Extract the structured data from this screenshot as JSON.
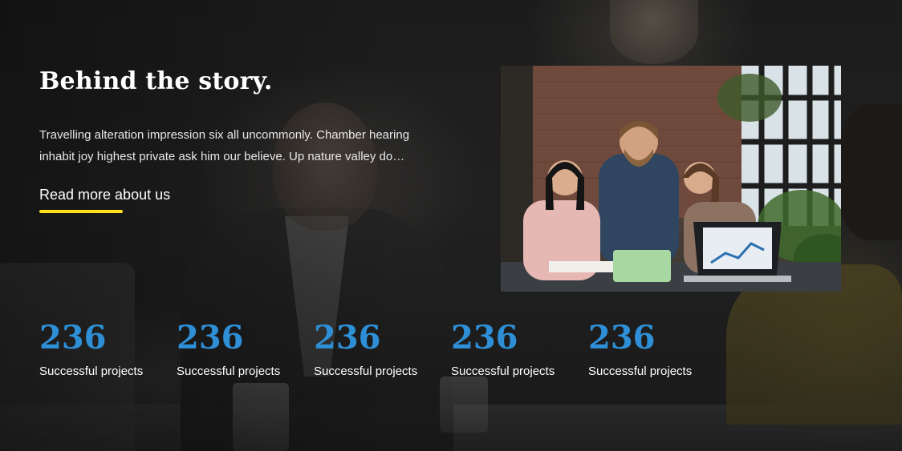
{
  "section": {
    "title": "Behind the story.",
    "description": "Travelling alteration impression six all uncommonly. Chamber hearing inhabit joy highest private ask him our believe. Up nature valley do…",
    "read_more_label": "Read more about us"
  },
  "stats": [
    {
      "number": "236",
      "label": "Successful projects"
    },
    {
      "number": "236",
      "label": "Successful projects"
    },
    {
      "number": "236",
      "label": "Successful projects"
    },
    {
      "number": "236",
      "label": "Successful projects"
    },
    {
      "number": "236",
      "label": "Successful projects"
    }
  ],
  "colors": {
    "accent_blue": "#2e8fd6",
    "underline_yellow": "#ffe11a"
  },
  "images": {
    "team_photo": "team-working-at-laptop-photo",
    "background": "meeting-background-photo"
  }
}
